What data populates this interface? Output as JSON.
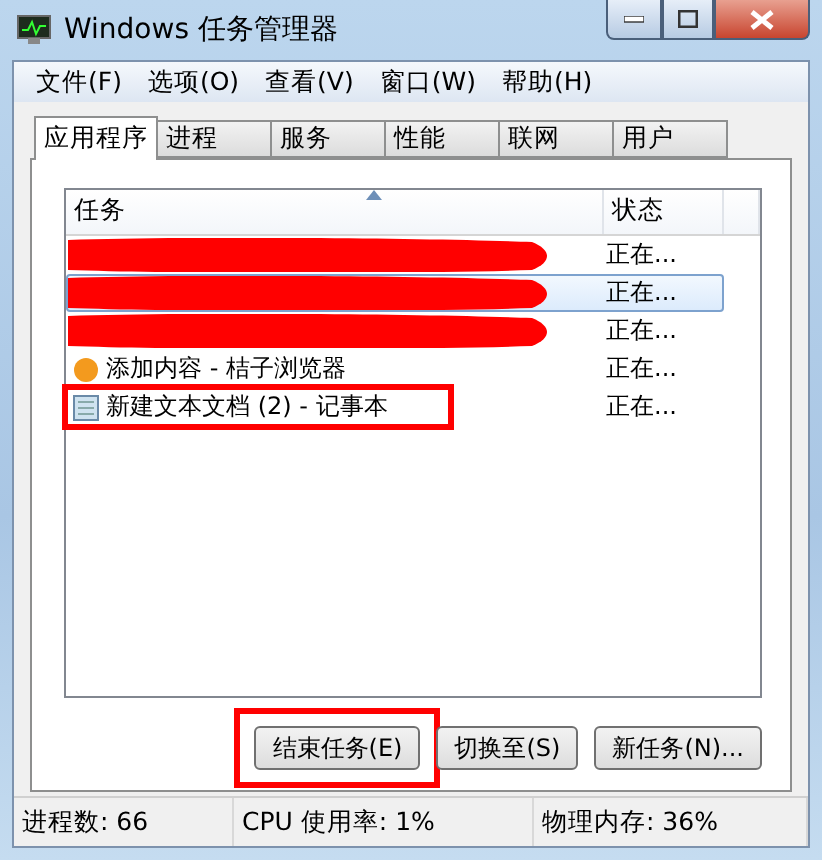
{
  "window": {
    "title": "Windows 任务管理器"
  },
  "menu": [
    "文件(F)",
    "选项(O)",
    "查看(V)",
    "窗口(W)",
    "帮助(H)"
  ],
  "tabs": [
    {
      "label": "应用程序",
      "selected": true
    },
    {
      "label": "进程",
      "selected": false
    },
    {
      "label": "服务",
      "selected": false
    },
    {
      "label": "性能",
      "selected": false
    },
    {
      "label": "联网",
      "selected": false
    },
    {
      "label": "用户",
      "selected": false
    }
  ],
  "table": {
    "columns": [
      "任务",
      "状态"
    ],
    "rows": [
      {
        "status": "正在...",
        "selected": false,
        "redacted": true
      },
      {
        "status": "正在...",
        "selected": true,
        "redacted": true
      },
      {
        "status": "正在...",
        "selected": false,
        "redacted": true
      },
      {
        "task": "添加内容 - 桔子浏览器",
        "status": "正在...",
        "selected": false,
        "redacted": false,
        "highlighted": false
      },
      {
        "task": "新建文本文档 (2) - 记事本",
        "status": "正在...",
        "selected": false,
        "redacted": false,
        "highlighted": true
      }
    ]
  },
  "buttons": [
    {
      "label": "结束任务(E)",
      "highlighted": true
    },
    {
      "label": "切换至(S)",
      "highlighted": false
    },
    {
      "label": "新任务(N)...",
      "highlighted": false
    }
  ],
  "status_bar": [
    "进程数: 66",
    "CPU 使用率: 1%",
    "物理内存: 36%"
  ]
}
